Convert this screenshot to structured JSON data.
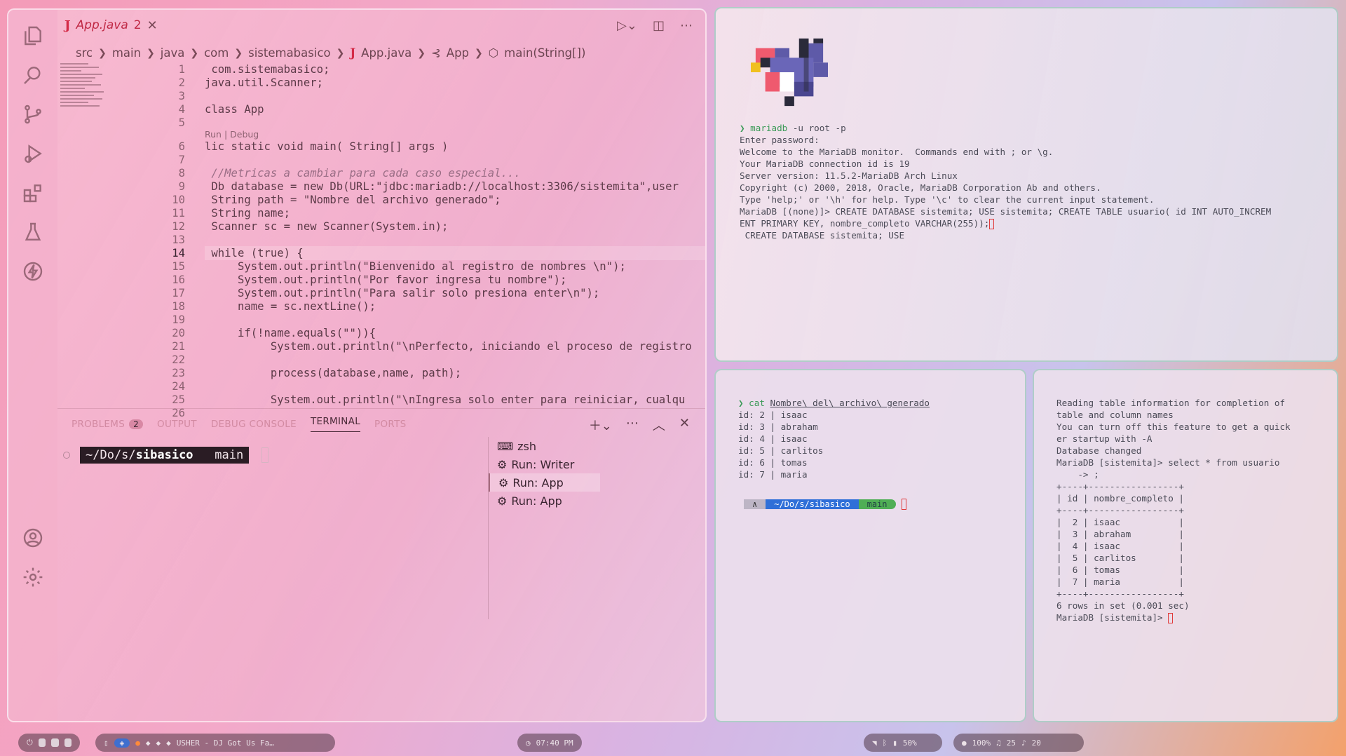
{
  "editor": {
    "tab": {
      "name": "App.java",
      "problems": "2",
      "icon": "J"
    },
    "breadcrumb": [
      "src",
      "main",
      "java",
      "com",
      "sistemabasico",
      "App.java",
      "App",
      "main(String[])"
    ],
    "codelens": "Run | Debug",
    "lines": [
      {
        "n": "1",
        "t": " com.sistemabasico;"
      },
      {
        "n": "2",
        "t": "java.util.Scanner;"
      },
      {
        "n": "3",
        "t": ""
      },
      {
        "n": "4",
        "t": "class App"
      },
      {
        "n": "5",
        "t": ""
      },
      {
        "n": "6",
        "t": "lic static void main( String[] args )"
      },
      {
        "n": "7",
        "t": ""
      },
      {
        "n": "8",
        "t": " //Metricas a cambiar para cada caso especial..."
      },
      {
        "n": "9",
        "t": " Db database = new Db(URL:\"jdbc:mariadb://localhost:3306/sistemita\",user"
      },
      {
        "n": "10",
        "t": " String path = \"Nombre del archivo generado\";"
      },
      {
        "n": "11",
        "t": " String name;"
      },
      {
        "n": "12",
        "t": " Scanner sc = new Scanner(System.in);"
      },
      {
        "n": "13",
        "t": ""
      },
      {
        "n": "14",
        "t": " while (true) {"
      },
      {
        "n": "15",
        "t": "     System.out.println(\"Bienvenido al registro de nombres \\n\");"
      },
      {
        "n": "16",
        "t": "     System.out.println(\"Por favor ingresa tu nombre\");"
      },
      {
        "n": "17",
        "t": "     System.out.println(\"Para salir solo presiona enter\\n\");"
      },
      {
        "n": "18",
        "t": "     name = sc.nextLine();"
      },
      {
        "n": "19",
        "t": ""
      },
      {
        "n": "20",
        "t": "     if(!name.equals(\"\")){"
      },
      {
        "n": "21",
        "t": "          System.out.println(\"\\nPerfecto, iniciando el proceso de registro"
      },
      {
        "n": "22",
        "t": ""
      },
      {
        "n": "23",
        "t": "          process(database,name, path);"
      },
      {
        "n": "24",
        "t": ""
      },
      {
        "n": "25",
        "t": "          System.out.println(\"\\nIngresa solo enter para reiniciar, cualqu"
      },
      {
        "n": "26",
        "t": ""
      }
    ],
    "active_line": "14"
  },
  "panel": {
    "tabs": [
      "PROBLEMS",
      "OUTPUT",
      "DEBUG CONSOLE",
      "TERMINAL",
      "PORTS"
    ],
    "problems_count": "2",
    "active_tab": "TERMINAL",
    "prompt_path": "~/Do/s/",
    "prompt_bold": "sibasico",
    "prompt_branch": "main",
    "terminals": [
      "zsh",
      "Run: Writer",
      "Run: App",
      "Run: App"
    ]
  },
  "term1": {
    "lines": [
      "Enter password:",
      "Welcome to the MariaDB monitor.  Commands end with ; or \\g.",
      "Your MariaDB connection id is 19",
      "Server version: 11.5.2-MariaDB Arch Linux",
      "",
      "Copyright (c) 2000, 2018, Oracle, MariaDB Corporation Ab and others.",
      "",
      "Type 'help;' or '\\h' for help. Type '\\c' to clear the current input statement.",
      "MariaDB [(none)]> CREATE DATABASE sistemita; USE sistemita; CREATE TABLE usuario( id INT AUTO_INCREM",
      "ENT PRIMARY KEY, nombre_completo VARCHAR(255));",
      " CREATE DATABASE sistemita; USE"
    ],
    "cmd": "mariadb",
    "cmd_args": " -u root -p"
  },
  "term2": {
    "cmd": "cat",
    "arg": "Nombre\\ del\\ archivo\\ generado",
    "rows": [
      "id: 2 | isaac",
      "id: 3 | abraham",
      "id: 4 | isaac",
      "id: 5 | carlitos",
      "id: 6 | tomas",
      "id: 7 | maria"
    ],
    "pl_path": "~/Do/s/sibasico",
    "pl_branch": "main"
  },
  "term3": {
    "lines": [
      "Reading table information for completion of",
      "table and column names",
      "You can turn off this feature to get a quick",
      "er startup with -A",
      "",
      "Database changed",
      "MariaDB [sistemita]> select * from usuario",
      "    -> ;",
      "+----+-----------------+",
      "| id | nombre_completo |",
      "+----+-----------------+",
      "|  2 | isaac           |",
      "|  3 | abraham         |",
      "|  4 | isaac           |",
      "|  5 | carlitos        |",
      "|  6 | tomas           |",
      "|  7 | maria           |",
      "+----+-----------------+",
      "6 rows in set (0.001 sec)",
      "",
      "MariaDB [sistemita]> "
    ]
  },
  "taskbar": {
    "media": "USHER - DJ Got Us Fa…",
    "clock": "07:40 PM",
    "battery": "50%",
    "status": "100%",
    "audio": "25",
    "notif": "20"
  },
  "colors": {
    "accent": "#d42a47",
    "prompt_bg": "#2a1c24",
    "green": "#3a9a57",
    "branch_blue": "#2f6fd8"
  }
}
